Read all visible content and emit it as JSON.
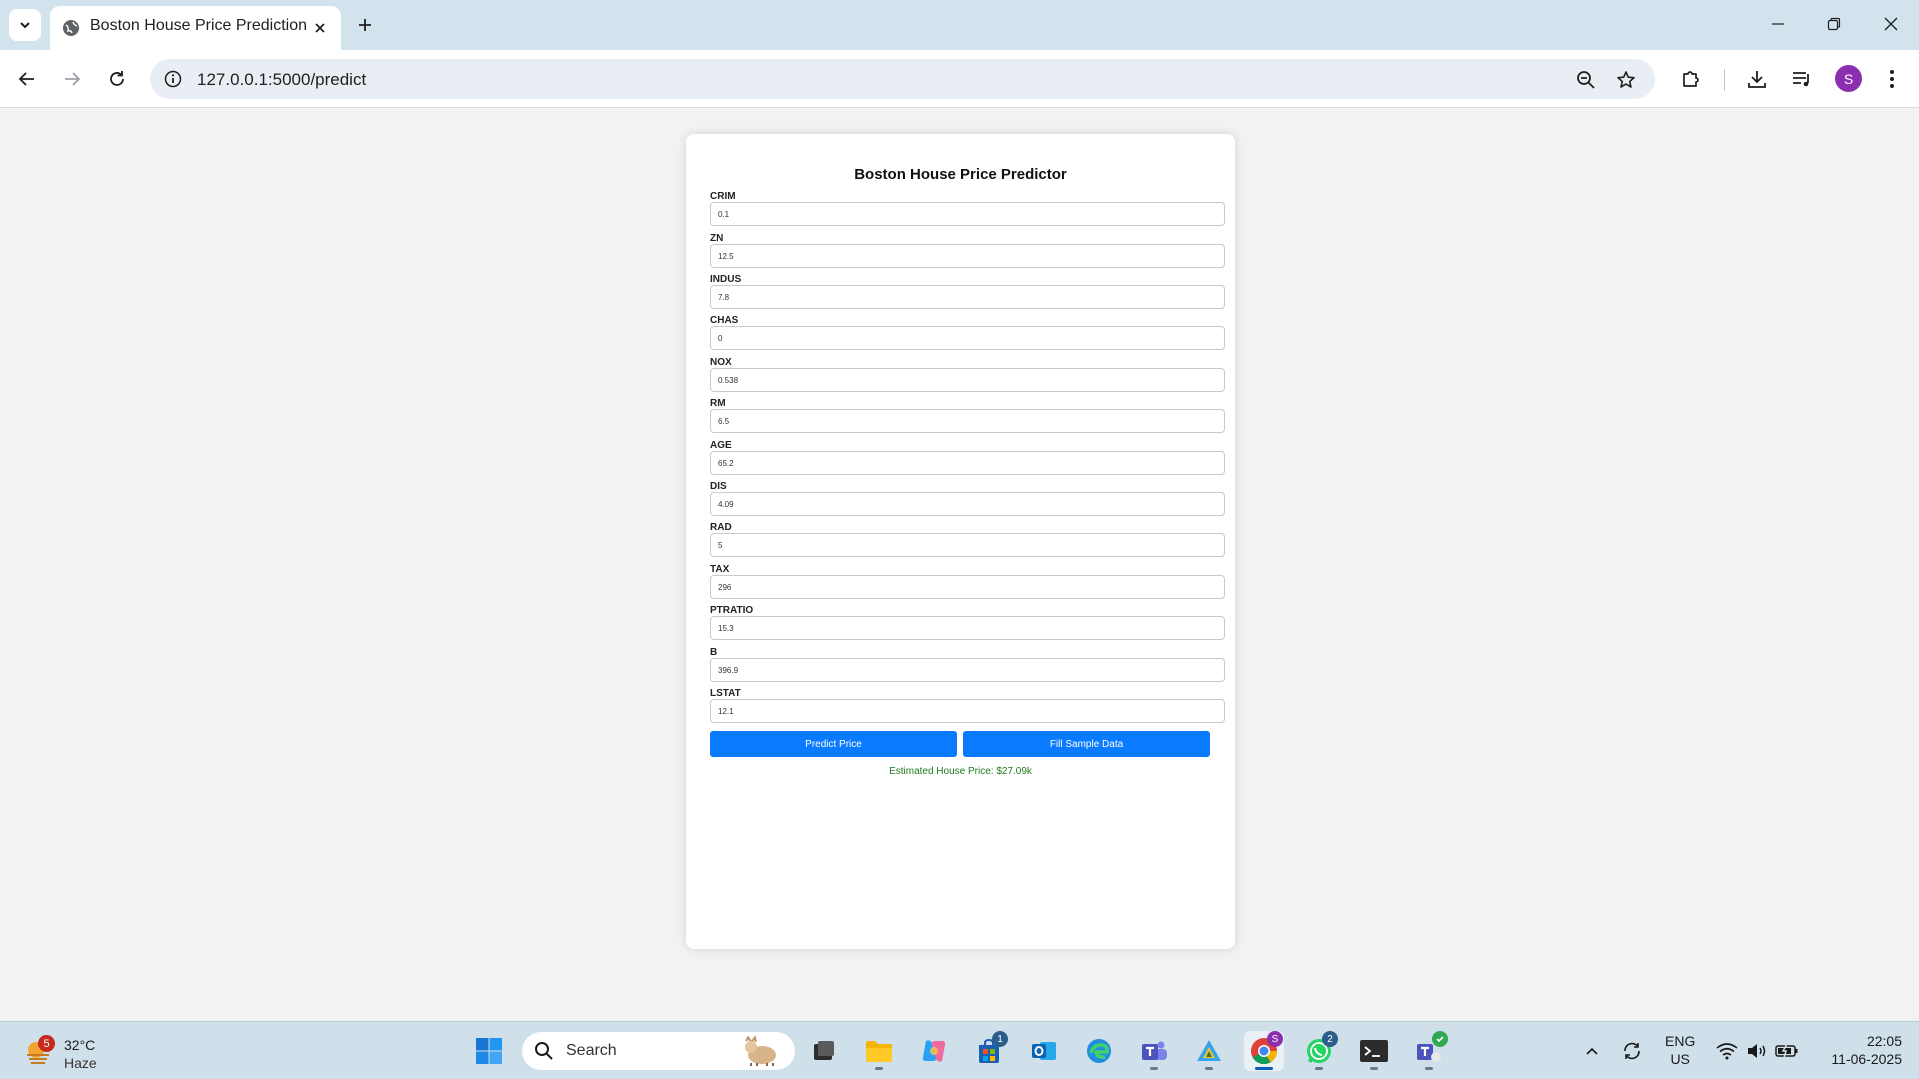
{
  "browser": {
    "tab_title": "Boston House Price Prediction",
    "url": "127.0.0.1:5000/predict",
    "profile_initial": "S"
  },
  "form": {
    "title": "Boston House Price Predictor",
    "fields": [
      {
        "label": "CRIM",
        "value": "0.1"
      },
      {
        "label": "ZN",
        "value": "12.5"
      },
      {
        "label": "INDUS",
        "value": "7.8"
      },
      {
        "label": "CHAS",
        "value": "0"
      },
      {
        "label": "NOX",
        "value": "0.538"
      },
      {
        "label": "RM",
        "value": "6.5"
      },
      {
        "label": "AGE",
        "value": "65.2"
      },
      {
        "label": "DIS",
        "value": "4.09"
      },
      {
        "label": "RAD",
        "value": "5"
      },
      {
        "label": "TAX",
        "value": "296"
      },
      {
        "label": "PTRATIO",
        "value": "15.3"
      },
      {
        "label": "B",
        "value": "396.9"
      },
      {
        "label": "LSTAT",
        "value": "12.1"
      }
    ],
    "predict_label": "Predict Price",
    "sample_label": "Fill Sample Data",
    "result_text": "Estimated House Price: $27.09k",
    "accent_color": "#0a7bff",
    "result_color": "#1e7a1e"
  },
  "taskbar": {
    "weather_badge": "5",
    "temperature": "32°C",
    "condition": "Haze",
    "search_label": "Search",
    "store_badge": "1",
    "whatsapp_badge": "2",
    "lang_line1": "ENG",
    "lang_line2": "US",
    "time": "22:05",
    "date": "11-06-2025"
  }
}
